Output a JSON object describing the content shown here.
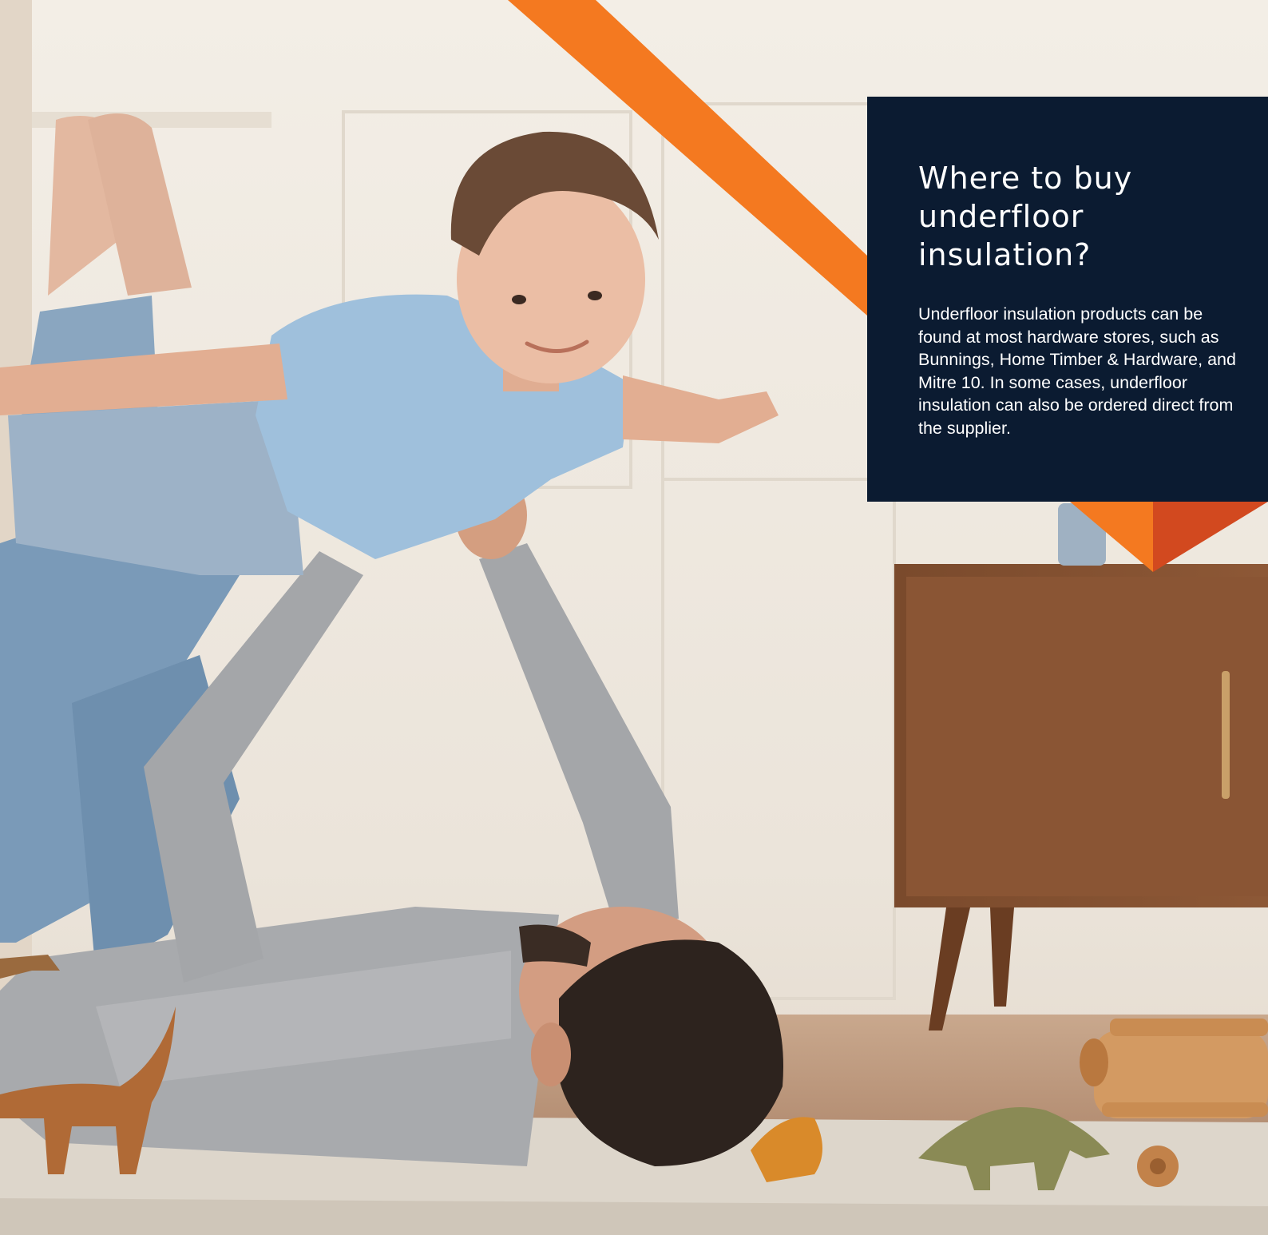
{
  "info_box": {
    "title": "Where to buy underfloor insulation?",
    "body": "Underfloor insulation products can be found at most hardware stores, such as Bunnings, Home Timber & Hardware, and Mitre 10. In some cases, underfloor insulation can also be ordered direct from the supplier."
  },
  "colors": {
    "panel_navy": "#0b1b31",
    "accent_orange": "#f47920",
    "accent_dark_orange": "#d2491f"
  }
}
